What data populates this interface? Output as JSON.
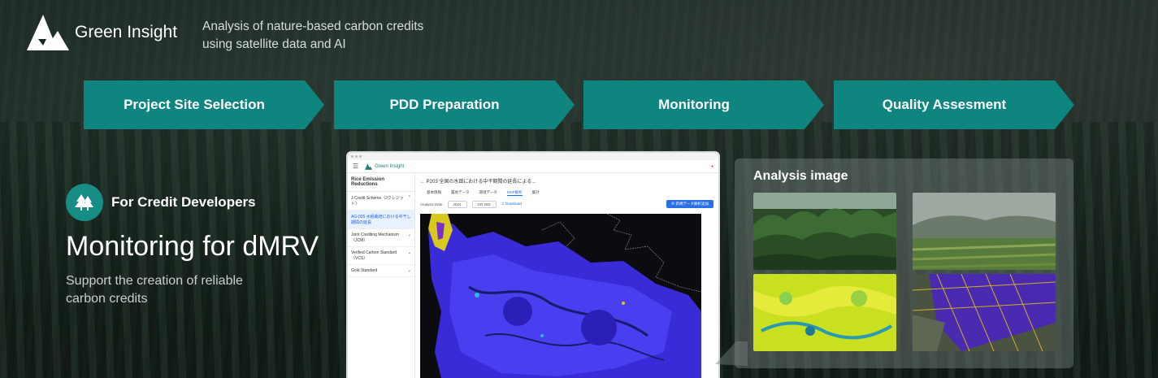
{
  "brand": {
    "name": "Green Insight",
    "tagline_line1": "Analysis of nature-based carbon credits",
    "tagline_line2": "using satellite data and AI"
  },
  "steps": [
    {
      "label": "Project Site Selection"
    },
    {
      "label": "PDD Preparation"
    },
    {
      "label": "Monitoring"
    },
    {
      "label": "Quality Assesment"
    }
  ],
  "developer": {
    "badge_label": "For Credit Developers",
    "title": "Monitoring for dMRV",
    "subtitle_line1": "Support the creation of reliable",
    "subtitle_line2": "carbon credits"
  },
  "app": {
    "brand": "Green Insight",
    "sidebar_title": "Rice Emission Reductions",
    "sidebar_items": [
      {
        "label": "J-Credit Scheme（Jクレジット）"
      },
      {
        "label": "AG-005 水稲栽培における中干し期間の延長"
      },
      {
        "label": "Joint Crediting Mechanism（JCM）"
      },
      {
        "label": "Verified Carbon Standard（VCS）"
      },
      {
        "label": "Gold Standard"
      }
    ],
    "breadcrumb": "P203 全国の水田における中干期間の延長による...",
    "tabs": [
      "基本情報",
      "農地データ",
      "環境データ",
      "MAP解析",
      "集計"
    ],
    "filter_label": "Analysis Date",
    "filter_year": "2024",
    "filter_period": "GR 25D",
    "download_label": "Download",
    "action_label": "新規データ解析追加"
  },
  "analysis": {
    "title": "Analysis image"
  },
  "colors": {
    "teal": "#0f8580",
    "badge": "#168e86",
    "link": "#1a6fe0"
  }
}
